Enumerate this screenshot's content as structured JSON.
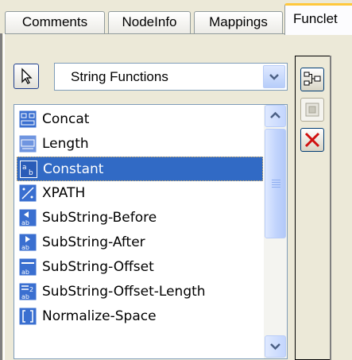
{
  "tabs": [
    {
      "label": "Comments"
    },
    {
      "label": "NodeInfo"
    },
    {
      "label": "Mappings"
    },
    {
      "label": "Funclet"
    }
  ],
  "active_tab": "Funclet",
  "category_select": {
    "value": "String Functions",
    "icon": "chevron-down-icon"
  },
  "pointer_tool": {
    "icon": "pointer-arrow-icon"
  },
  "functions": [
    {
      "label": "Concat",
      "icon": "concat-icon"
    },
    {
      "label": "Length",
      "icon": "length-icon"
    },
    {
      "label": "Constant",
      "icon": "constant-icon",
      "selected": true
    },
    {
      "label": "XPATH",
      "icon": "xpath-icon"
    },
    {
      "label": "SubString-Before",
      "icon": "substring-before-icon"
    },
    {
      "label": "SubString-After",
      "icon": "substring-after-icon"
    },
    {
      "label": "SubString-Offset",
      "icon": "substring-offset-icon"
    },
    {
      "label": "SubString-Offset-Length",
      "icon": "substring-offset-length-icon"
    },
    {
      "label": "Normalize-Space",
      "icon": "normalize-space-icon"
    }
  ],
  "toolbar": [
    {
      "icon": "tree-structure-icon",
      "enabled": true
    },
    {
      "icon": "add-node-icon",
      "enabled": false
    },
    {
      "icon": "delete-x-icon",
      "enabled": true
    }
  ],
  "colors": {
    "selection": "#316ac5",
    "active_tab_accent": "#ffc83c",
    "icon_blue": "#3a6fd0",
    "delete_red": "#d01010"
  }
}
